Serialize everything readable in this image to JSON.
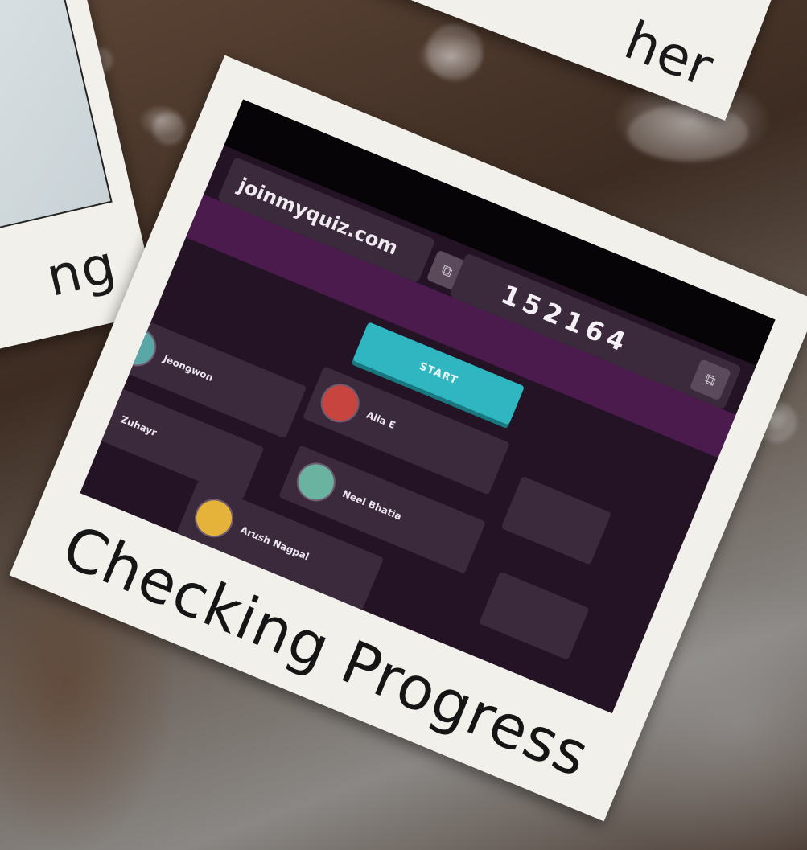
{
  "cards": [
    {
      "caption": "ng"
    },
    {
      "caption": "her"
    },
    {
      "caption": "Checking Progress"
    }
  ],
  "quiz_screen": {
    "join_url": "joinmyquiz.com",
    "game_code": "152164",
    "copy_icon": "copy-icon",
    "start_label": "START",
    "players": [
      {
        "name": "Alia E",
        "avatar_color": "#c8453f"
      },
      {
        "name": "Jeongwon",
        "avatar_color": "#5aa7a8"
      },
      {
        "name": "Zuhayr",
        "avatar_color": "#d8863a"
      },
      {
        "name": "Neel Bhatia",
        "avatar_color": "#69b3a0"
      },
      {
        "name": "Arush Nagpal",
        "avatar_color": "#e5b23a"
      }
    ]
  },
  "colors": {
    "card": "#f1f0ea",
    "screen_bg": "#241325",
    "band": "#4a1b4c",
    "start": "#2fb6c0",
    "tile": "#3a2a3b"
  }
}
